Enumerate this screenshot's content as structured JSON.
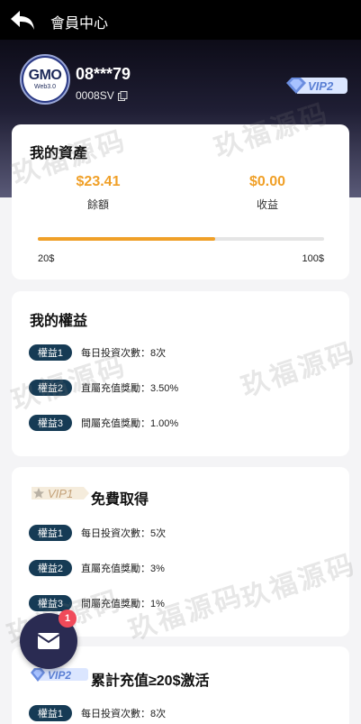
{
  "header": {
    "title": "會員中心"
  },
  "profile": {
    "logo_main": "GMO",
    "logo_sub": "Web3.0",
    "username": "08***79",
    "user_id": "0008SV",
    "vip_level": "VIP2"
  },
  "assets": {
    "title": "我的資產",
    "balance_value": "$23.41",
    "balance_label": "餘額",
    "earnings_value": "$0.00",
    "earnings_label": "收益",
    "progress": 0.62,
    "progress_min": "20$",
    "progress_max": "100$"
  },
  "rights": {
    "title": "我的權益",
    "items": [
      {
        "tag": "權益1",
        "text": "每日投資次數：8次"
      },
      {
        "tag": "權益2",
        "text": "直屬充值獎勵：3.50%"
      },
      {
        "tag": "權益3",
        "text": "間屬充值獎勵：1.00%"
      }
    ]
  },
  "vip1": {
    "badge": "VIP1",
    "title": "免費取得",
    "items": [
      {
        "tag": "權益1",
        "text": "每日投資次數：5次"
      },
      {
        "tag": "權益2",
        "text": "直屬充值獎勵：3%"
      },
      {
        "tag": "權益3",
        "text": "間屬充值獎勵：1%"
      }
    ]
  },
  "vip2": {
    "badge": "VIP2",
    "title": "累計充值≥20$激活",
    "items": [
      {
        "tag": "權益1",
        "text": "每日投資次數：8次"
      }
    ]
  },
  "messages": {
    "unread_count": "1"
  },
  "watermark": "玖福源码",
  "colors": {
    "accent": "#f0a028",
    "tag_bg": "#163b55",
    "badge": "#f04a5a"
  }
}
